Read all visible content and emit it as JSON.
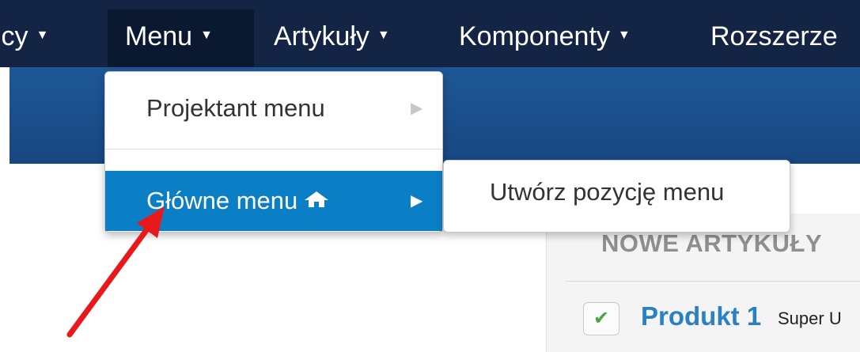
{
  "nav": {
    "items": [
      {
        "label": "icy",
        "caret": "▼"
      },
      {
        "label": "Menu",
        "caret": "▼"
      },
      {
        "label": "Artykuły",
        "caret": "▼"
      },
      {
        "label": "Komponenty",
        "caret": "▼"
      },
      {
        "label": "Rozszerze",
        "caret": ""
      }
    ]
  },
  "dropdown": {
    "items": [
      {
        "label": "Projektant menu",
        "arrow": "▶"
      },
      {
        "label": "Główne menu",
        "arrow": "▶",
        "icon": "home-icon"
      }
    ]
  },
  "submenu": {
    "label": "Utwórz pozycję menu"
  },
  "content": {
    "title": "NOWE ARTYKUŁY",
    "check": "✔",
    "product_name": "Produkt 1",
    "product_desc": "Super U"
  },
  "colors": {
    "topbar": "#132444",
    "subbar": "#1b4f8f",
    "active_item": "#0b7fc6",
    "link": "#2a80c0",
    "annotation_arrow": "#e8191b"
  }
}
